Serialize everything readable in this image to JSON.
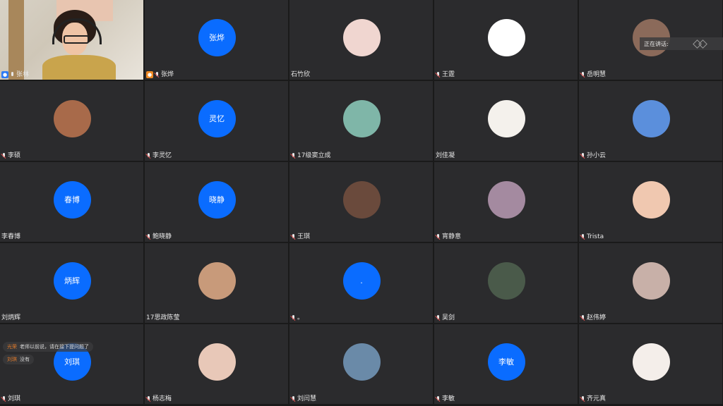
{
  "speaking": {
    "label": "正在讲话:"
  },
  "tiles": [
    {
      "name": "张林",
      "type": "video",
      "badge": "host",
      "mic": "on"
    },
    {
      "name": "张烨",
      "type": "text",
      "avatar_text": "张烨",
      "badge": "cohost",
      "mic": "off"
    },
    {
      "name": "石竹欣",
      "type": "photo",
      "mic": "none",
      "color": "#f0d6d0"
    },
    {
      "name": "王霆",
      "type": "photo",
      "mic": "off",
      "color": "#ffffff"
    },
    {
      "name": "岳明慧",
      "type": "photo",
      "mic": "off",
      "color": "#8b6a5a"
    },
    {
      "name": "李硕",
      "type": "photo",
      "mic": "off",
      "color": "#a86a4a"
    },
    {
      "name": "李灵忆",
      "type": "text",
      "avatar_text": "灵忆",
      "mic": "off"
    },
    {
      "name": "17级窦立成",
      "type": "photo",
      "mic": "off",
      "color": "#7fb6a8"
    },
    {
      "name": "刘佳凝",
      "type": "photo",
      "mic": "none",
      "color": "#f4f1ec"
    },
    {
      "name": "孙小云",
      "type": "plain",
      "mic": "off"
    },
    {
      "name": "李春博",
      "type": "text",
      "avatar_text": "春博",
      "mic": "none"
    },
    {
      "name": "鲍晓静",
      "type": "text",
      "avatar_text": "晓静",
      "mic": "off"
    },
    {
      "name": "王琪",
      "type": "photo",
      "mic": "off",
      "color": "#6a4a3c"
    },
    {
      "name": "宵静意",
      "type": "photo",
      "mic": "off",
      "color": "#a48aa0"
    },
    {
      "name": "Trista",
      "type": "photo",
      "mic": "off",
      "color": "#f0c8b0"
    },
    {
      "name": "刘炳辉",
      "type": "text",
      "avatar_text": "炳辉",
      "mic": "none"
    },
    {
      "name": "17思政陈莹",
      "type": "photo",
      "mic": "none",
      "color": "#c89a7a"
    },
    {
      "name": "。",
      "type": "text",
      "avatar_text": ".",
      "mic": "off"
    },
    {
      "name": "吴剑",
      "type": "photo",
      "mic": "off",
      "color": "#4a5a4a"
    },
    {
      "name": "赵伟婷",
      "type": "photo",
      "mic": "off",
      "color": "#c8b0a8"
    },
    {
      "name": "刘琪",
      "type": "text",
      "avatar_text": "刘琪",
      "mic": "off"
    },
    {
      "name": "杨志梅",
      "type": "photo",
      "mic": "off",
      "color": "#e8c8b8"
    },
    {
      "name": "刘闫慧",
      "type": "photo",
      "mic": "off",
      "color": "#6a8aa8"
    },
    {
      "name": "李敏",
      "type": "text",
      "avatar_text": "李敏",
      "mic": "off"
    },
    {
      "name": "齐元真",
      "type": "photo",
      "mic": "off",
      "color": "#f4eeea"
    }
  ],
  "chat": [
    {
      "sender": "光荣",
      "text": "老师以前说，请在接下提问题了"
    },
    {
      "sender": "刘琪",
      "text": "没有"
    }
  ],
  "icons": {
    "mic": "mic-icon",
    "host": "user-icon"
  }
}
